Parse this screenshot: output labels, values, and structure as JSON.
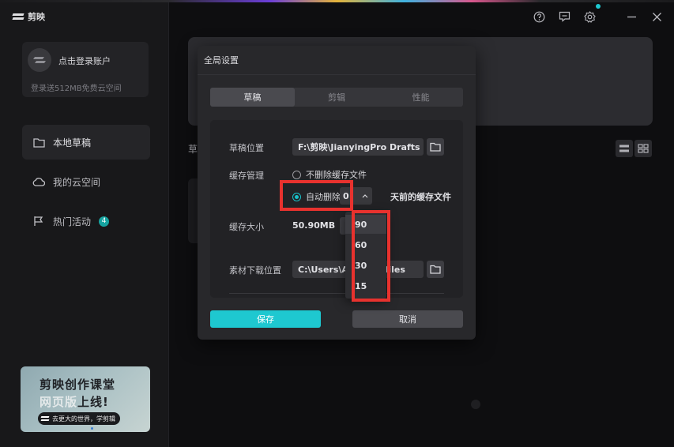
{
  "app": {
    "name": "剪映"
  },
  "sidebar": {
    "login_title": "点击登录账户",
    "login_subtitle": "登录送512MB免费云空间",
    "items": [
      {
        "label": "本地草稿",
        "icon": "folder-icon",
        "active": true
      },
      {
        "label": "我的云空间",
        "icon": "cloud-icon",
        "active": false
      },
      {
        "label": "热门活动",
        "icon": "flag-icon",
        "active": false,
        "badge": "4"
      }
    ],
    "promo": {
      "line1": "剪映创作课堂",
      "line2_highlight": "网页版",
      "line2_rest": "上线!",
      "slogan": "去更大的世界，学剪辑"
    }
  },
  "main": {
    "section_label": "草"
  },
  "dialog": {
    "title": "全局设置",
    "tabs": [
      {
        "label": "草稿",
        "active": true
      },
      {
        "label": "剪辑",
        "active": false
      },
      {
        "label": "性能",
        "active": false
      }
    ],
    "draft_location": {
      "label": "草稿位置",
      "value": "F:\\剪映\\JianyingPro Drafts"
    },
    "cache_management": {
      "label": "缓存管理",
      "option_keep": "不删除缓存文件",
      "option_auto": "自动删除",
      "selected": "auto",
      "days_value": "0",
      "days_suffix": "天前的缓存文件"
    },
    "cache_size": {
      "label": "缓存大小",
      "value": "50.90MB"
    },
    "download_location": {
      "label": "素材下载位置",
      "value_left": "C:\\Users\\A",
      "value_right": "files"
    },
    "save_label": "保存",
    "cancel_label": "取消"
  },
  "days_dropdown": {
    "options": [
      "90",
      "60",
      "30",
      "15"
    ],
    "selected": "90"
  },
  "colors": {
    "accent": "#1ec8d0",
    "highlight": "#e8322e",
    "badge": "#16a3a0"
  }
}
